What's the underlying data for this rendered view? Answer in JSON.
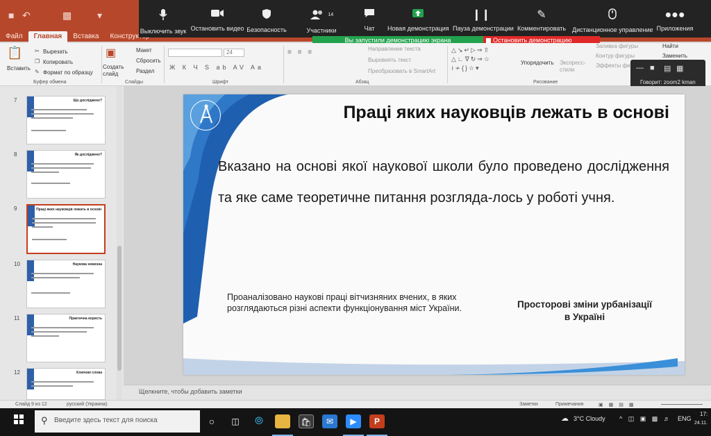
{
  "ribbon_tabs": [
    "Файл",
    "Главная",
    "Вставка",
    "Конструктор"
  ],
  "zoom": {
    "buttons": [
      {
        "icon": "microphone-icon",
        "label": "Выключить звук"
      },
      {
        "icon": "video-camera-icon",
        "label": "Остановить видео"
      },
      {
        "icon": "shield-icon",
        "label": "Безопасность"
      },
      {
        "icon": "participants-icon",
        "label": "Участники",
        "count": "14"
      },
      {
        "icon": "chat-icon",
        "label": "Чат"
      },
      {
        "icon": "share-screen-icon",
        "label": "Новая демонстрация"
      },
      {
        "icon": "pause-icon",
        "label": "Пауза демонстрации"
      },
      {
        "icon": "pencil-icon",
        "label": "Комментировать"
      },
      {
        "icon": "remote-control-icon",
        "label": "Дистанционное управление"
      },
      {
        "icon": "more-icon",
        "label": "Приложения"
      }
    ],
    "share_notice": "Вы запустили демонстрацию экрана",
    "stop_share": "Остановить демонстрацию",
    "speaking": "Говорит: zoom2 kman"
  },
  "ribbon": {
    "paste": "Вставить",
    "cut": "Вырезать",
    "copy": "Копировать",
    "format_painter": "Формат по образцу",
    "clipboard_group": "Буфер обмена",
    "new_slide": "Создать слайд",
    "layout": "Макет",
    "reset": "Сбросить",
    "section": "Раздел",
    "slides_group": "Слайды",
    "font_size": "24",
    "font_group": "Шрифт",
    "text_direction": "Направление текста",
    "align_text": "Выровнять текст",
    "smartart": "Преобразовать в SmartArt",
    "paragraph_group": "Абзац",
    "arrange": "Упорядочить",
    "quick_styles": "Экспресс-стили",
    "drawing_group": "Рисование",
    "shape_fill": "Заливка фигуры",
    "shape_outline": "Контур фигуры",
    "shape_effects": "Эффекты фи",
    "find": "Найти",
    "replace": "Заменить"
  },
  "thumbnails": [
    {
      "num": "7",
      "title": "Що досліджено?"
    },
    {
      "num": "8",
      "title": "Як досліджено?"
    },
    {
      "num": "9",
      "title": "Праці яких науковців лежать в основі"
    },
    {
      "num": "10",
      "title": "Наукова новизна"
    },
    {
      "num": "11",
      "title": "Практична користь"
    },
    {
      "num": "12",
      "title": "Ключові слова"
    }
  ],
  "slide": {
    "title": "Праці яких науковців лежать в основі",
    "body": "Вказано на основі якої наукової школи було проведено дослідження та яке саме теоретичне питання розгляда-лось у роботі учня.",
    "left_text": "Проаналізовано наукові праці вітчизняних вчених, в яких розглядаються різні аспекти функціонування міст України.",
    "right_text": "Просторові зміни урбанізації в Україні"
  },
  "notes_placeholder": "Щелкните, чтобы добавить заметки",
  "status": {
    "slide_of": "Слайд 9 из 12",
    "language": "русский (Украина)",
    "notes": "Заметки",
    "comments": "Примечания"
  },
  "taskbar": {
    "search_placeholder": "Введите здесь текст для поиска",
    "weather": "3°C  Cloudy",
    "lang": "ENG",
    "time": "17:",
    "date": "24.11."
  },
  "colors": {
    "ribbon_red": "#b7472a",
    "zoom_dark": "#232323",
    "share_green": "#23a24d",
    "stop_red": "#e02828",
    "slide_blue": "#1f5fb0"
  }
}
